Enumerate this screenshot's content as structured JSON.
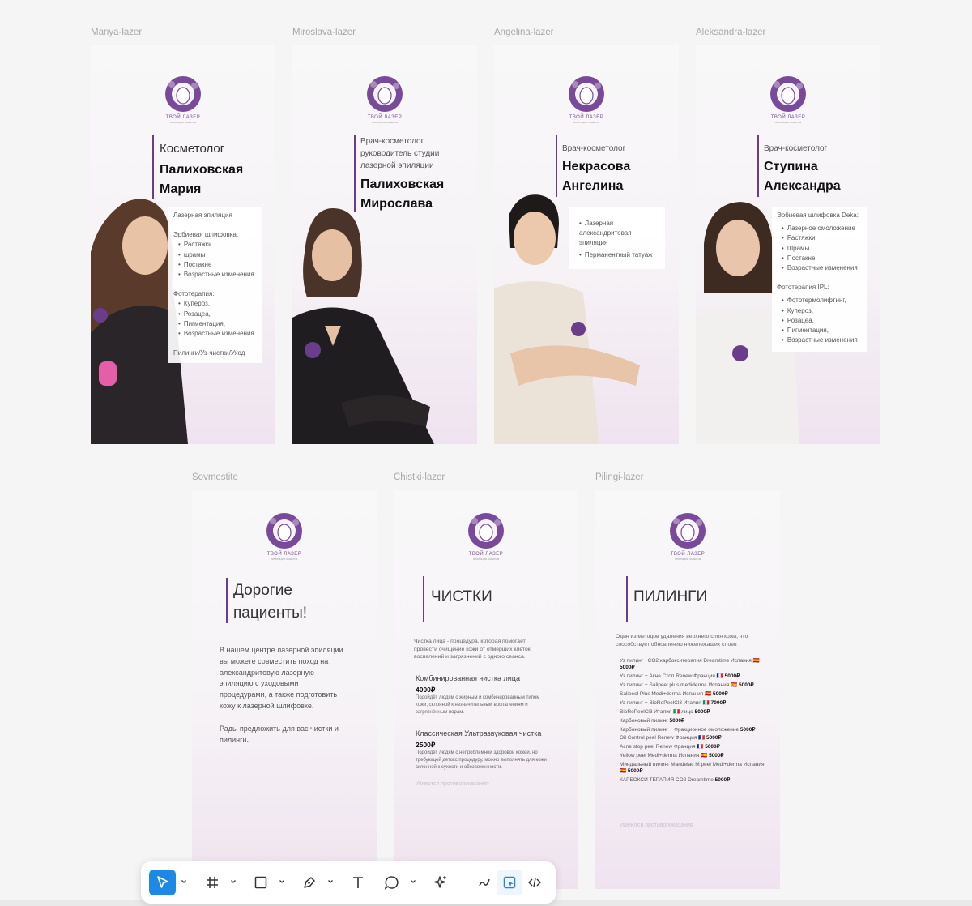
{
  "frames_row1": [
    {
      "label": "Mariya-lazer",
      "role": "Косметолог",
      "name1": "Палиховская",
      "name2": "Мария"
    },
    {
      "label": "Miroslava-lazer",
      "role1": "Врач-косметолог,",
      "role2": "руководитель студии",
      "role3": "лазерной эпиляции",
      "name1": "Палиховская",
      "name2": "Мирослава"
    },
    {
      "label": "Angelina-lazer",
      "role": "Врач-косметолог",
      "name1": "Некрасова",
      "name2": "Ангелина"
    },
    {
      "label": "Aleksandra-lazer",
      "role": "Врач-косметолог",
      "name1": "Ступина",
      "name2": "Александра"
    }
  ],
  "logo": {
    "name": "ТВОЙ ЛАЗЕР",
    "sub": "ЭПИЛЯЦИЯ ЛАЗЕРОМ"
  },
  "mariya_info": {
    "line1": "Лазерная эпиляция",
    "erbium_title": "Эрбиевая шлифовка:",
    "erbium": [
      "Растяжки",
      "шрамы",
      "Постакне",
      "Возрастные изменения"
    ],
    "photo_title": "Фототерапия:",
    "photo": [
      "Купероз,",
      "Розацеа,",
      "Пигментация,",
      "Возрастные изменения"
    ],
    "last": "Пилинги/Уз-чистки/Уход"
  },
  "angelina_info": {
    "items": [
      "Лазерная александритовая эпиляция",
      "Перманентный татуаж"
    ]
  },
  "aleksandra_info": {
    "erbium_title": "Эрбиевая шлифовка Deka:",
    "erbium": [
      "Лазерное омоложение",
      "Растяжки",
      "Шрамы",
      "Постакне",
      "Возрастные изменения"
    ],
    "photo_title": "Фототерапия IPL:",
    "photo": [
      "Фототермолифтинг,",
      "Купероз,",
      "Розацеа,",
      "Пигментация,",
      "Возрастные изменения"
    ]
  },
  "frames_row2": [
    {
      "label": "Sovmestite"
    },
    {
      "label": "Chistki-lazer"
    },
    {
      "label": "Pilingi-lazer"
    }
  ],
  "sovmestite": {
    "title1": "Дорогие",
    "title2": "пациенты!",
    "p1": [
      "В нашем центре лазерной эпиляции",
      "вы можете совместить поход на",
      "александритовую лазерную",
      "эпиляцию с уходовыми",
      "процедурами, а также подготовить",
      "кожу к лазерной шлифовке."
    ],
    "p2": [
      "Рады предложить для вас чистки и",
      "пилинги."
    ]
  },
  "chistki": {
    "title": "ЧИСТКИ",
    "intro": [
      "Чистка лица - процедура, которая помогает",
      "провести очищение кожи от отмерших клеток,",
      "воспалений и загрязнений с одного сеанса."
    ],
    "s1_title": "Комбинированная чистка лица",
    "s1_price": "4000₽",
    "s1_desc": [
      "Подойдёт людям с жирным и комбинированным типом",
      "кожи, склонной к незначительным воспалениям и",
      "загрязнённым порам."
    ],
    "s2_title": "Классическая Ультразвуковая чистка",
    "s2_price": "2500₽",
    "s2_desc": [
      "Подойдёт людям с непроблемной здоровой кожей, но",
      "требующей детокс процедуру, можно выполнять для кожи",
      "склонной к сухости и обезвоженности."
    ],
    "note": "Имеются противопоказания"
  },
  "pilingi": {
    "title": "ПИЛИНГИ",
    "intro": [
      "Один из методов удаления верхнего слоя кожи, что",
      "способствует обновлению нижележащих слоев"
    ],
    "items": [
      {
        "text": "Уз пилинг +CO2 карбокситерапия Dreamtime Испания 🇪🇸",
        "price": "5000₽"
      },
      {
        "text": "Уз пилинг + Акне Стоп Renew Франция 🇫🇷",
        "price": "5000₽"
      },
      {
        "text": "Уз пилинг + Salipeel plus mediderma Испания 🇪🇸",
        "price": "5000₽"
      },
      {
        "text": "Salipeel Plus Medi+derma Испания 🇪🇸",
        "price": "5000₽"
      },
      {
        "text": "Уз пилинг + BioRePeelCl3 Италия 🇮🇹",
        "price": "7000₽"
      },
      {
        "text": "BioRePeelCl3 Италия 🇮🇹 лицо",
        "price": "5000₽"
      },
      {
        "text": "Карбоновый пилинг",
        "price": "5000₽"
      },
      {
        "text": "Карбоновый пилинг + Фракционное омоложение",
        "price": "5000₽"
      },
      {
        "text": "Oil Control peel Renew Франция 🇫🇷",
        "price": "5000₽"
      },
      {
        "text": "Acne stop peel Renew Франция 🇫🇷",
        "price": "5000₽"
      },
      {
        "text": "Yellow peel Medi+derma Испания 🇪🇸",
        "price": "5000₽"
      },
      {
        "text": "Миндальный пилинг Mandelac M peel Medi+derma Испания 🇪🇸",
        "price": "5000₽"
      },
      {
        "text": "КАРБОКСИ ТЕРАПИЯ CO2 Dreamtime",
        "price": "5000₽"
      }
    ],
    "note": "Имеются противопоказания"
  },
  "toolbar": {
    "tools": [
      "move-tool",
      "frame-tool",
      "shape-tool",
      "pen-tool",
      "text-tool",
      "comment-tool",
      "actions-tool"
    ],
    "modes": [
      "draw-mode",
      "design-mode",
      "dev-mode"
    ]
  },
  "colors": {
    "accent": "#1e88e5",
    "brand": "#6a3d8a"
  }
}
